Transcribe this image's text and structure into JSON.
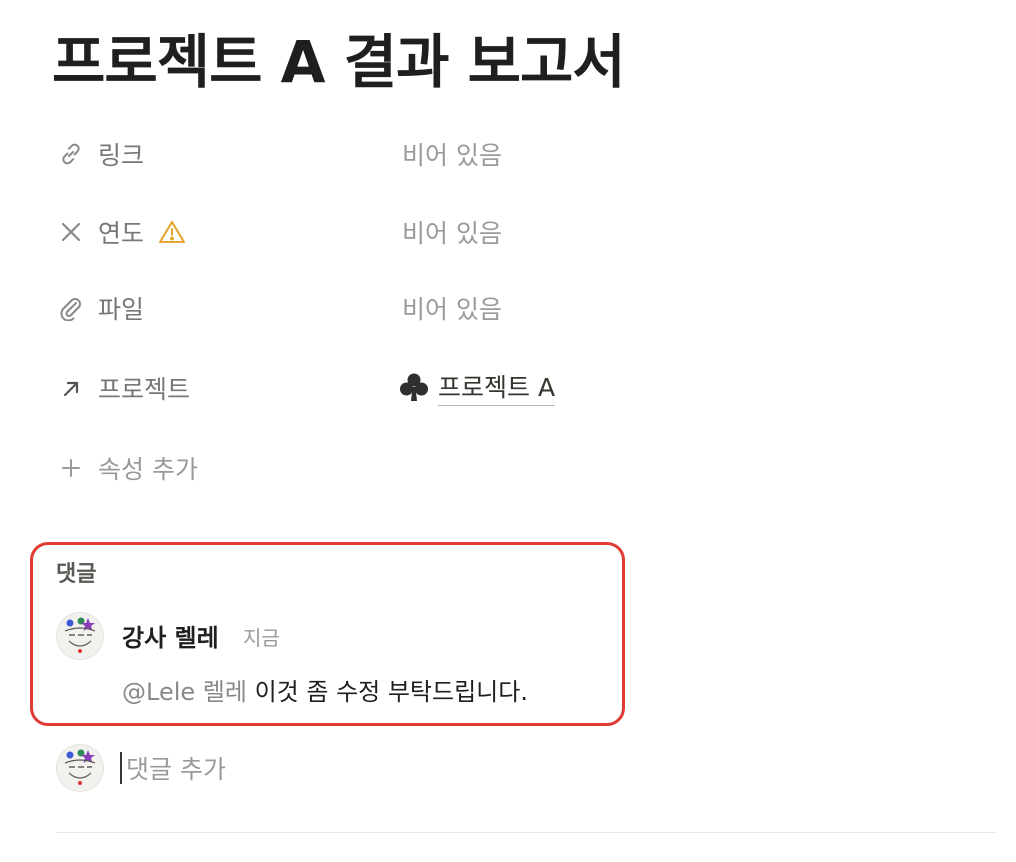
{
  "page": {
    "title": "프로젝트 A 결과 보고서"
  },
  "properties": [
    {
      "name": "링크",
      "icon": "link-icon",
      "value": "비어 있음"
    },
    {
      "name": "연도",
      "icon": "close-x-icon",
      "warning_icon": "warning-icon",
      "value": "비어 있음"
    },
    {
      "name": "파일",
      "icon": "paperclip-icon",
      "value": "비어 있음"
    },
    {
      "name": "프로젝트",
      "icon": "arrow-up-right-icon",
      "value": "프로젝트 A",
      "value_icon": "club-icon"
    }
  ],
  "add_property": {
    "icon": "plus-icon",
    "label": "속성 추가"
  },
  "comments": {
    "heading": "댓글",
    "items": [
      {
        "author": "강사 렐레",
        "time": "지금",
        "mention": "@Lele 렐레",
        "text": " 이것 좀 수정 부탁드립니다."
      }
    ],
    "add_placeholder": "댓글 추가"
  },
  "colors": {
    "highlight_border": "#e03a35",
    "warning": "#e0a52a",
    "muted_text": "#9b9a97"
  }
}
